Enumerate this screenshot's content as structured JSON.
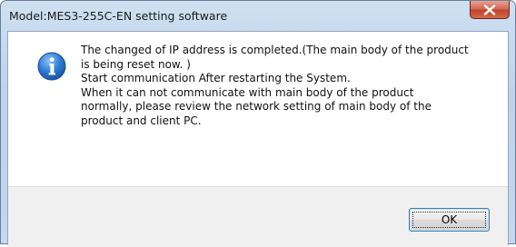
{
  "window": {
    "title": "Model:MES3-255C-EN setting software"
  },
  "icons": {
    "close": "close-icon",
    "info": "information-icon"
  },
  "message": {
    "lines": [
      "The changed of IP address is completed.(The main body of the product",
      "is being reset now. )",
      "Start communication After restarting the System.",
      "When it can not communicate with main body of the product",
      "normally, please review the network setting of main body of the",
      "product and client PC."
    ]
  },
  "buttons": {
    "ok_label": "OK"
  },
  "colors": {
    "title_bar": "#bcd3ea",
    "close_button": "#c2442d",
    "info_icon": "#2b6cc4",
    "button_bar": "#f0f0f0"
  }
}
